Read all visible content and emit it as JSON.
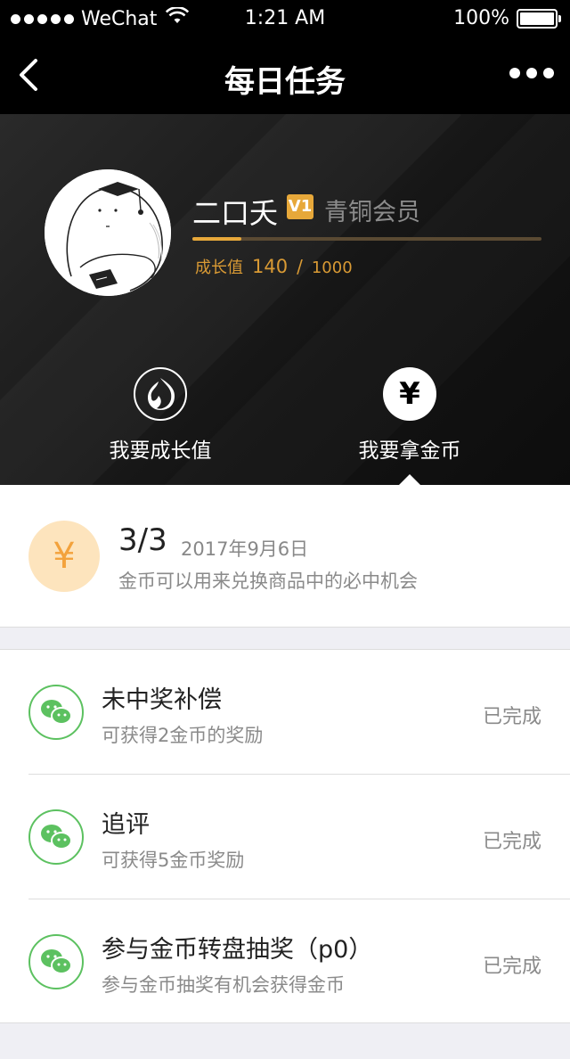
{
  "status_bar": {
    "carrier": "WeChat",
    "time": "1:21 AM",
    "battery": "100%"
  },
  "nav": {
    "title": "每日任务"
  },
  "profile": {
    "name": "二口夭",
    "level_badge": "V1",
    "member_label": "青铜会员",
    "growth_label": "成长值",
    "growth_value": "140",
    "growth_sep": "/",
    "growth_max": "1000",
    "progress_fraction": 0.14
  },
  "hero_tabs": [
    {
      "label": "我要成长值",
      "icon": "flame-icon"
    },
    {
      "label": "我要拿金币",
      "icon": "yuan-icon",
      "glyph": "¥"
    }
  ],
  "summary": {
    "coin_glyph": "¥",
    "count": "3/3",
    "date": "2017年9月6日",
    "desc": "金币可以用来兑换商品中的必中机会"
  },
  "tasks": [
    {
      "title": "未中奖补偿",
      "desc": "可获得2金币的奖励",
      "status": "已完成",
      "icon": "wechat-icon"
    },
    {
      "title": "追评",
      "desc": "可获得5金币奖励",
      "status": "已完成",
      "icon": "wechat-icon"
    },
    {
      "title": "参与金币转盘抽奖（p0）",
      "desc": "参与金币抽奖有机会获得金币",
      "status": "已完成",
      "icon": "wechat-icon"
    }
  ],
  "colors": {
    "accent_gold": "#e7a83a",
    "coin_orange": "#f3a23c",
    "wechat_green": "#5cc160"
  }
}
